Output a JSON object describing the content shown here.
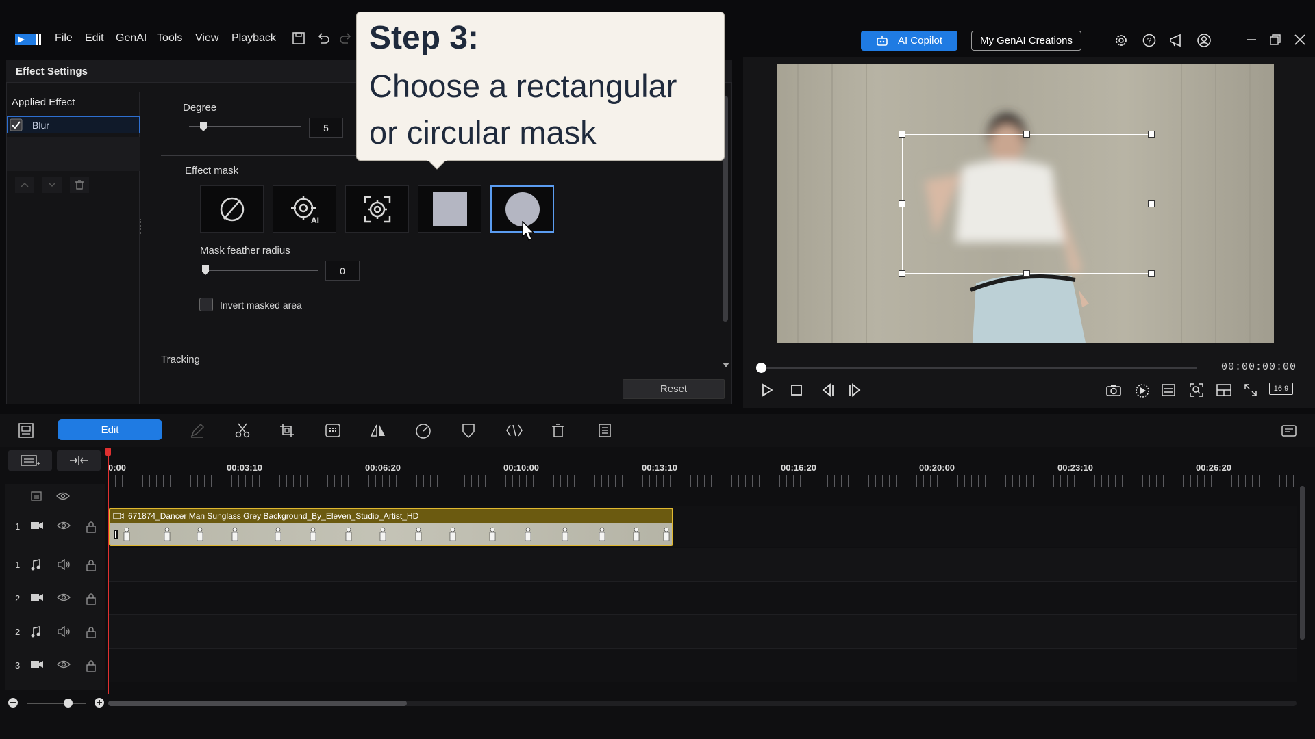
{
  "app": {
    "menu": [
      "File",
      "Edit",
      "GenAI",
      "Tools",
      "View",
      "Playback"
    ],
    "ai_copilot_label": "AI Copilot",
    "genai_creations_label": "My GenAI Creations",
    "accent": "#1f7be3"
  },
  "effect_settings": {
    "title": "Effect Settings",
    "applied_effect_label": "Applied Effect",
    "effect_name": "Blur",
    "degree_label": "Degree",
    "degree_value": "5",
    "effect_mask_label": "Effect mask",
    "mask_options": [
      "none",
      "ai-object",
      "object",
      "rectangle",
      "circle"
    ],
    "selected_mask": "circle",
    "feather_label": "Mask feather radius",
    "feather_value": "0",
    "invert_label": "Invert masked area",
    "tracking_label": "Tracking",
    "reset_label": "Reset"
  },
  "callout": {
    "title": "Step 3:",
    "line1": "Choose a rectangular",
    "line2": "or circular mask"
  },
  "preview": {
    "timecode": "00:00:00:00",
    "aspect": "16:9"
  },
  "timeline": {
    "edit_label": "Edit",
    "ruler": [
      "0:00",
      "00:03:10",
      "00:06:20",
      "00:10:00",
      "00:13:10",
      "00:16:20",
      "00:20:00",
      "00:23:10",
      "00:26:20"
    ],
    "clip_name": "671874_Dancer Man Sunglass Grey Background_By_Eleven_Studio_Artist_HD",
    "tracks": [
      {
        "num": "1",
        "type": "video"
      },
      {
        "num": "1",
        "type": "audio"
      },
      {
        "num": "2",
        "type": "video"
      },
      {
        "num": "2",
        "type": "audio"
      },
      {
        "num": "3",
        "type": "video"
      }
    ]
  }
}
